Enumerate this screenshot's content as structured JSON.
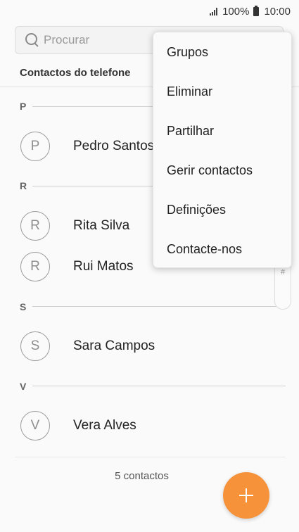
{
  "status_bar": {
    "battery_level": "100%",
    "time": "10:00",
    "signal_icon": "signal-icon",
    "battery_icon": "battery-icon"
  },
  "search": {
    "placeholder": "Procurar",
    "icon": "search-icon"
  },
  "section": {
    "title": "Contactos do telefone"
  },
  "groups": [
    {
      "letter": "P",
      "contacts": [
        {
          "initial": "P",
          "name": "Pedro Santos"
        }
      ]
    },
    {
      "letter": "R",
      "contacts": [
        {
          "initial": "R",
          "name": "Rita Silva"
        },
        {
          "initial": "R",
          "name": "Rui Matos"
        }
      ]
    },
    {
      "letter": "S",
      "contacts": [
        {
          "initial": "S",
          "name": "Sara Campos"
        }
      ]
    },
    {
      "letter": "V",
      "contacts": [
        {
          "initial": "V",
          "name": "Vera Alves"
        }
      ]
    }
  ],
  "index_pill": {
    "label": "#"
  },
  "footer": {
    "count_label": "5 contactos"
  },
  "fab": {
    "icon": "plus-icon",
    "color": "#f5923a"
  },
  "menu": {
    "items": [
      {
        "label": "Grupos"
      },
      {
        "label": "Eliminar"
      },
      {
        "label": "Partilhar"
      },
      {
        "label": "Gerir contactos"
      },
      {
        "label": "Definições"
      },
      {
        "label": "Contacte-nos"
      }
    ]
  }
}
